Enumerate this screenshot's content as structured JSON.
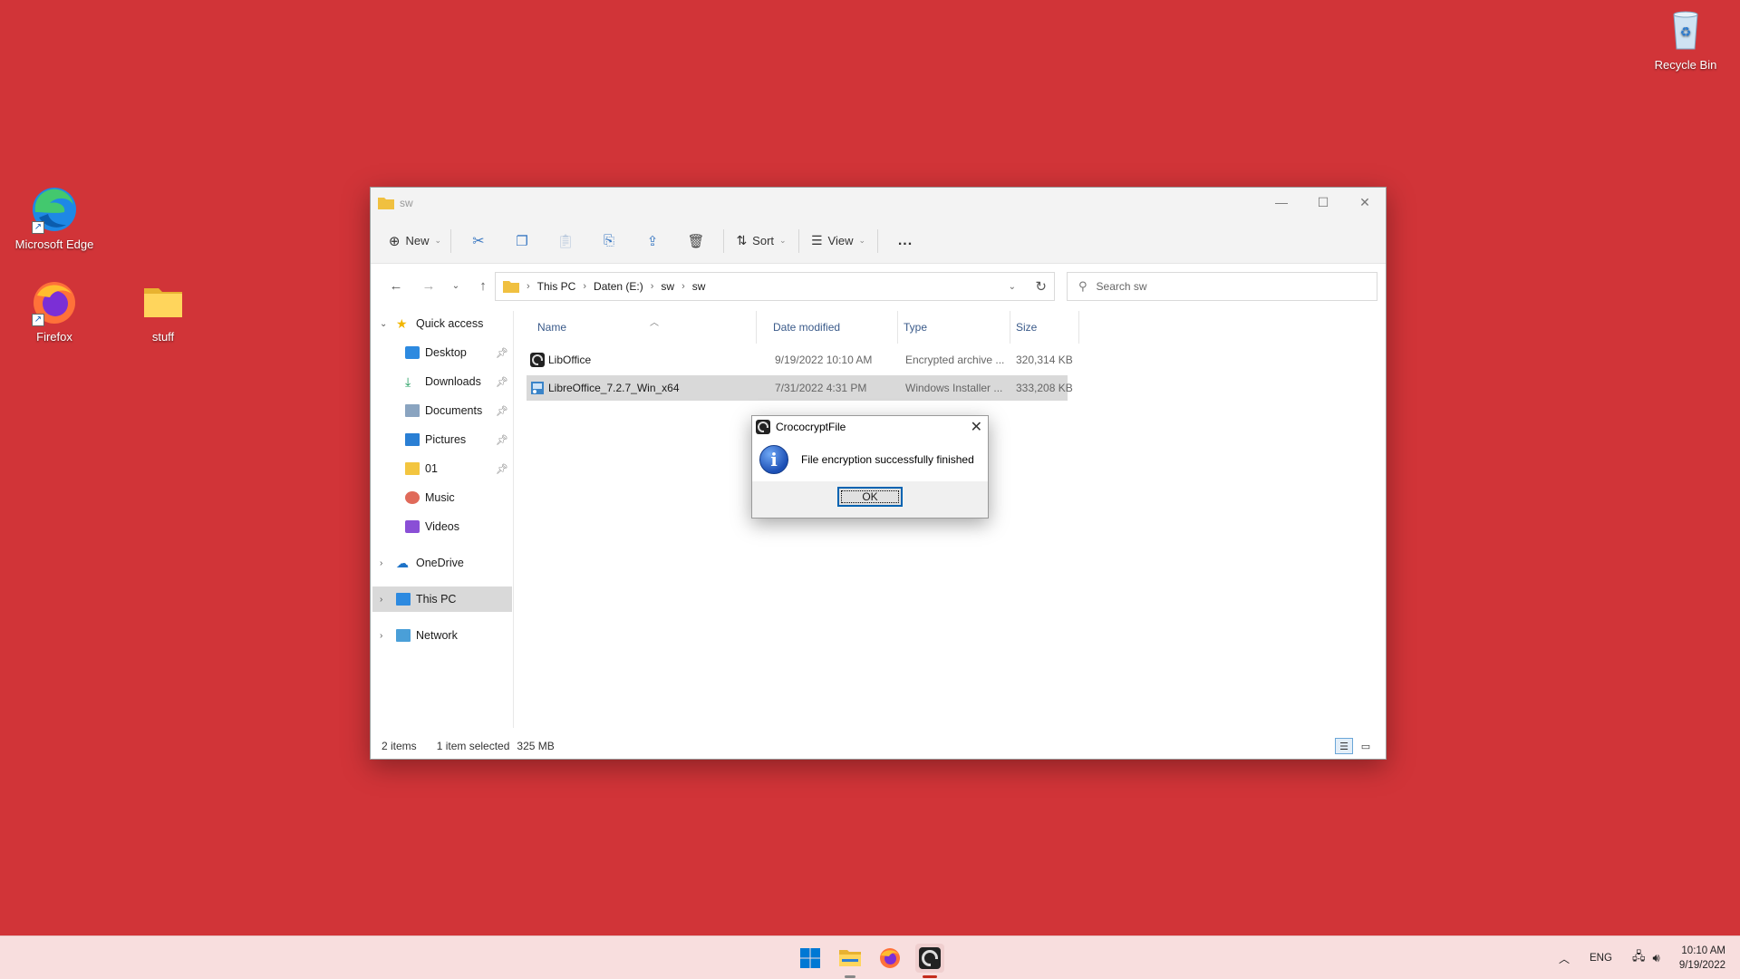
{
  "desktop": {
    "icons": [
      {
        "label": "Microsoft Edge",
        "icon": "edge-icon"
      },
      {
        "label": "Firefox",
        "icon": "firefox-icon"
      },
      {
        "label": "stuff",
        "icon": "folder-icon"
      },
      {
        "label": "Recycle Bin",
        "icon": "recycle-bin-icon"
      }
    ]
  },
  "explorer": {
    "title": "sw",
    "toolbar": {
      "new_label": "New",
      "sort_label": "Sort",
      "view_label": "View",
      "more_label": "..."
    },
    "address": {
      "crumbs": [
        "This PC",
        "Daten (E:)",
        "sw",
        "sw"
      ]
    },
    "search": {
      "placeholder": "Search sw"
    },
    "nav": {
      "quick_access": "Quick access",
      "items": [
        {
          "label": "Desktop",
          "icon": "desktop-icon",
          "pinned": true
        },
        {
          "label": "Downloads",
          "icon": "download-icon",
          "pinned": true
        },
        {
          "label": "Documents",
          "icon": "documents-icon",
          "pinned": true
        },
        {
          "label": "Pictures",
          "icon": "pictures-icon",
          "pinned": true
        },
        {
          "label": "01",
          "icon": "folder-icon",
          "pinned": true
        },
        {
          "label": "Music",
          "icon": "music-icon",
          "pinned": false
        },
        {
          "label": "Videos",
          "icon": "videos-icon",
          "pinned": false
        }
      ],
      "onedrive": "OneDrive",
      "this_pc": "This PC",
      "network": "Network"
    },
    "columns": {
      "name": "Name",
      "date": "Date modified",
      "type": "Type",
      "size": "Size"
    },
    "files": [
      {
        "name": "LibOffice",
        "date": "9/19/2022 10:10 AM",
        "type": "Encrypted archive ...",
        "size": "320,314 KB",
        "icon": "crococrypt-icon",
        "selected": false
      },
      {
        "name": "LibreOffice_7.2.7_Win_x64",
        "date": "7/31/2022 4:31 PM",
        "type": "Windows Installer ...",
        "size": "333,208 KB",
        "icon": "installer-icon",
        "selected": true
      }
    ],
    "status": {
      "items": "2 items",
      "selected": "1 item selected",
      "size": "325 MB"
    }
  },
  "dialog": {
    "title": "CrococryptFile",
    "message": "File encryption successfully finished",
    "ok_label": "OK"
  },
  "taskbar": {
    "lang": "ENG",
    "time": "10:10 AM",
    "date": "9/19/2022"
  },
  "colors": {
    "desktop": "#d13438",
    "accent": "#0063b1"
  }
}
